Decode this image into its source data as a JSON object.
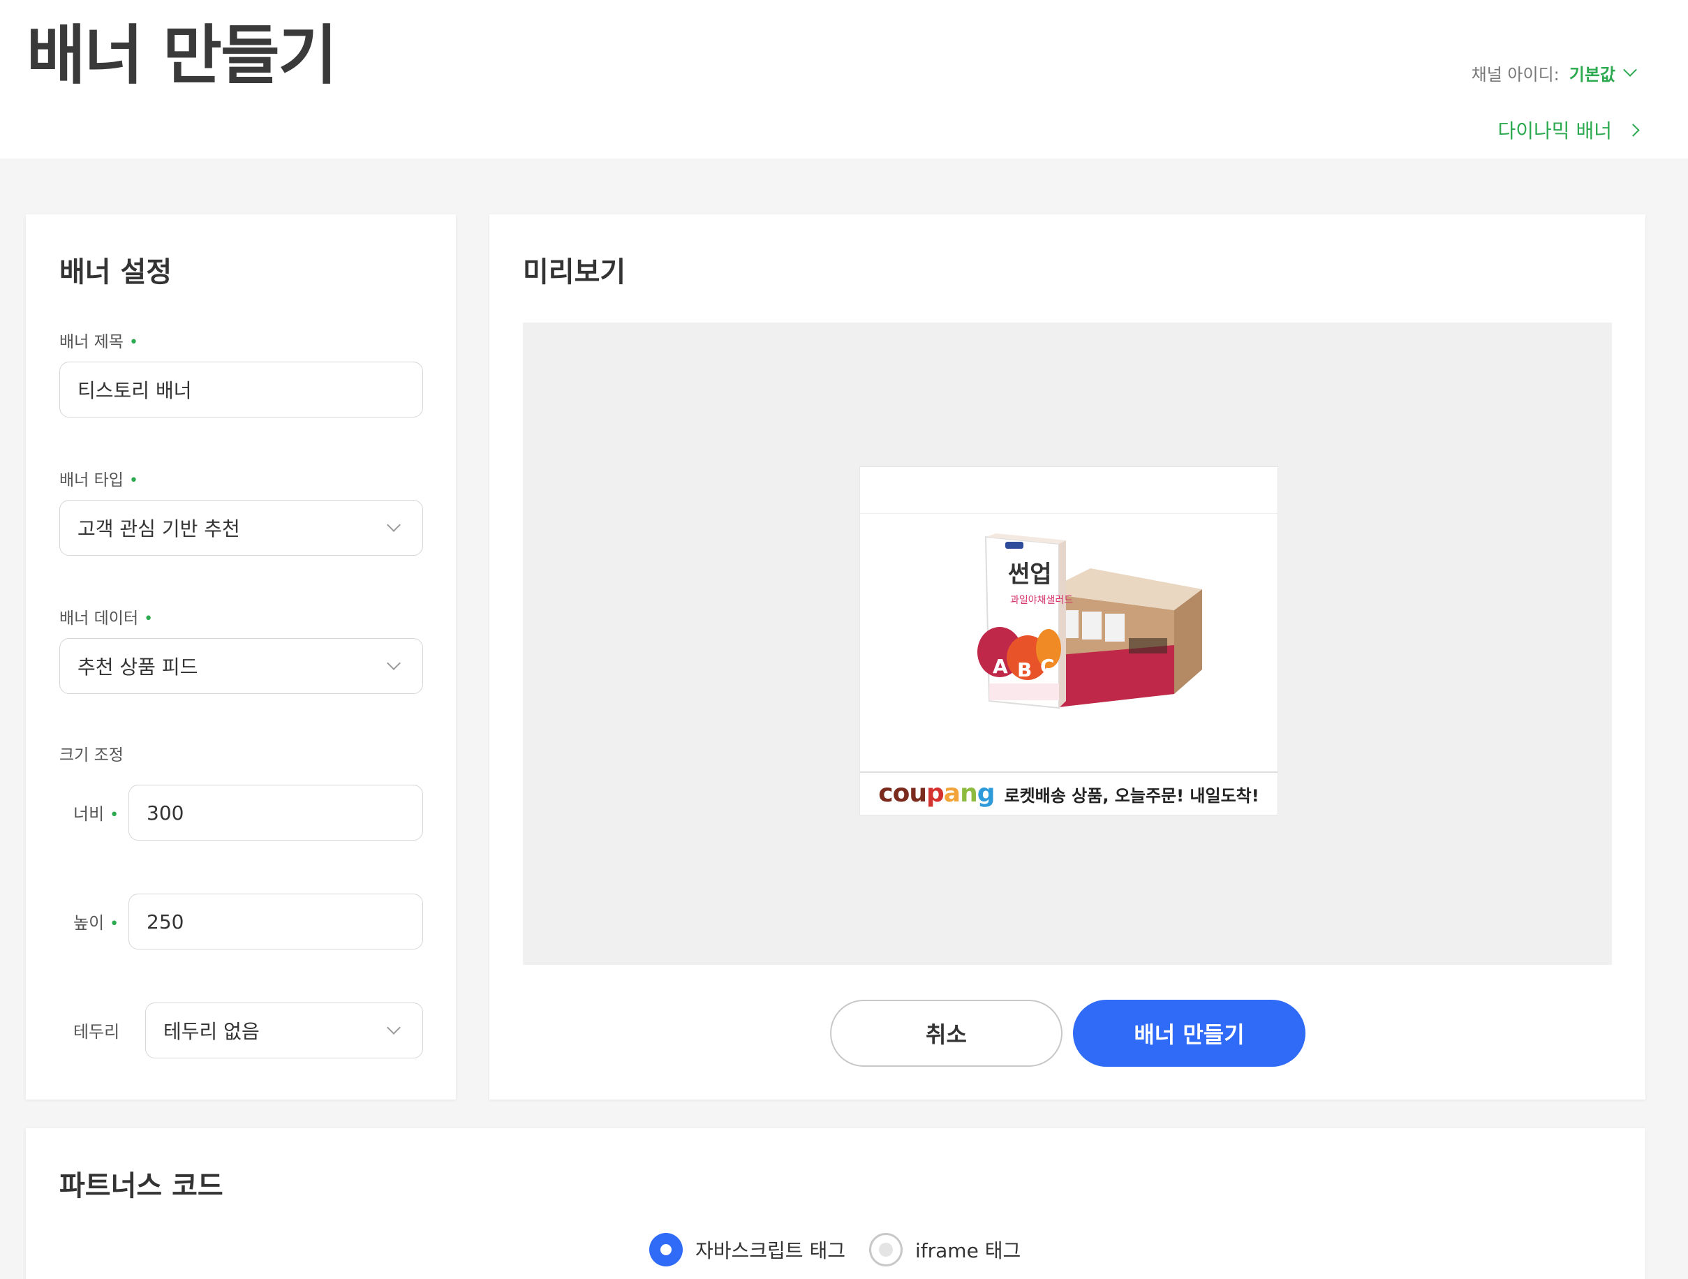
{
  "header": {
    "title": "배너 만들기",
    "channel_label": "채널 아이디:",
    "channel_value": "기본값",
    "dynamic_banner_link": "다이나믹 배너"
  },
  "settings": {
    "title": "배너 설정",
    "banner_title_label": "배너 제목",
    "banner_title_value": "티스토리 배너",
    "banner_type_label": "배너 타입",
    "banner_type_value": "고객 관심 기반 추천",
    "banner_data_label": "배너 데이터",
    "banner_data_value": "추천 상품 피드",
    "size_label": "크기 조정",
    "width_label": "너비",
    "width_value": "300",
    "height_label": "높이",
    "height_value": "250",
    "border_label": "테두리",
    "border_value": "테두리 없음",
    "required_mark": "•"
  },
  "preview": {
    "title": "미리보기",
    "banner_logo": "coupang",
    "banner_tagline": "로켓배송 상품, 오늘주문! 내일도착!",
    "cancel_button": "취소",
    "create_button": "배너 만들기"
  },
  "code": {
    "title": "파트너스 코드",
    "options": [
      {
        "label": "자바스크립트 태그",
        "selected": true
      },
      {
        "label": "iframe 태그",
        "selected": false
      }
    ]
  },
  "colors": {
    "accent_green": "#2daa4f",
    "primary_blue": "#2f6bf6"
  }
}
